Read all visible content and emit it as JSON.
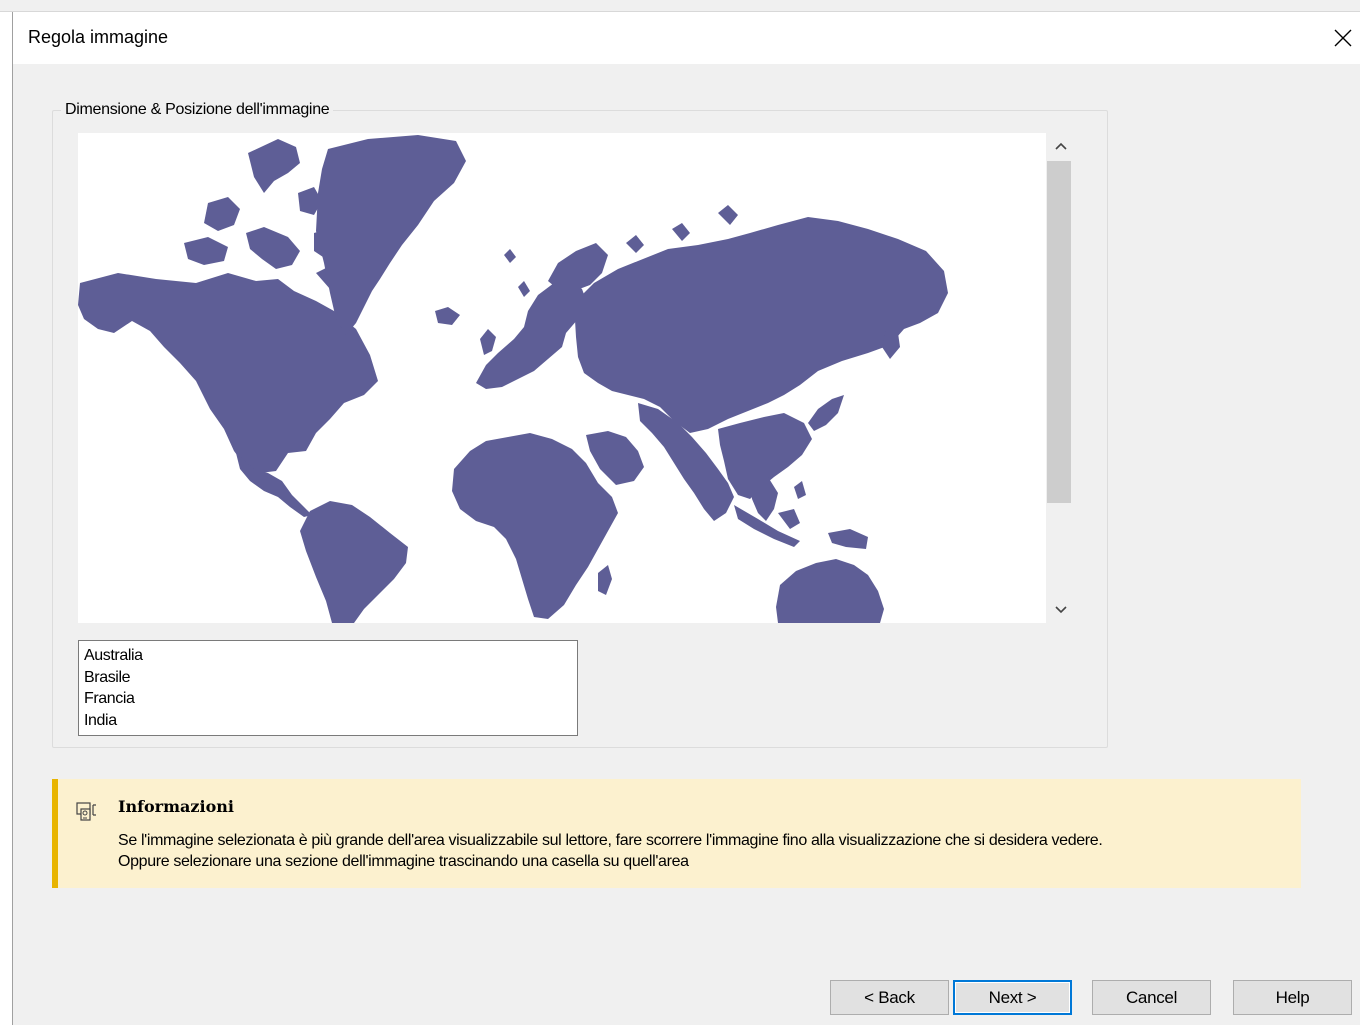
{
  "window": {
    "title": "Regola immagine",
    "close_icon": "close-icon"
  },
  "group": {
    "legend": "Dimensione & Posizione dell'immagine"
  },
  "map": {
    "icon": "world-map-image",
    "land_color": "#5e5e96"
  },
  "list": {
    "items": [
      "Australia",
      "Brasile",
      "Francia",
      "India"
    ]
  },
  "info": {
    "icon": "info-icon",
    "title": "Informazioni",
    "line1": "Se l'immagine selezionata è più grande dell'area visualizzabile sul lettore, fare scorrere l'immagine fino alla visualizzazione che si desidera vedere.",
    "line2": "Oppure selezionare una sezione dell'immagine trascinando una casella su quell'area",
    "accent": "#e8b400",
    "background": "#fcf1cf"
  },
  "buttons": {
    "back": "< Back",
    "next": "Next >",
    "cancel": "Cancel",
    "help": "Help"
  }
}
